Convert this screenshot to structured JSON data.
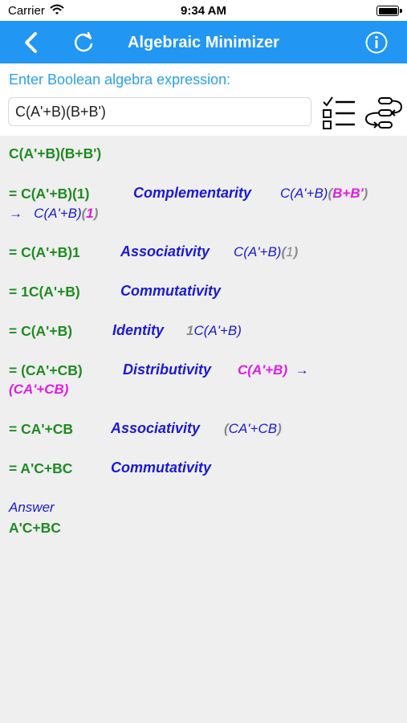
{
  "status_bar": {
    "carrier": "Carrier",
    "time": "9:34 AM",
    "battery_level": 0.9
  },
  "nav": {
    "title": "Algebraic Minimizer",
    "back_icon": "chevron-left-icon",
    "refresh_icon": "refresh-icon",
    "info_icon": "info-icon"
  },
  "input": {
    "prompt": "Enter Boolean algebra expression:",
    "value": "C(A'+B)(B+B')"
  },
  "colors": {
    "nav_blue": "#2196f3",
    "step_green": "#1f8b22",
    "law_blue": "#1a1ad6",
    "highlight_magenta": "#e01ce6",
    "muted_gray": "#8a8a8a"
  },
  "steps": {
    "initial": "C(A'+B)(B+B')",
    "s1": {
      "expr": "= C(A'+B)(1)",
      "law": "Complementarity",
      "n1": "C(A'+B)",
      "n2": "(",
      "n3": "B+B'",
      "n4": ")",
      "arrow": "→",
      "n5": "C(A'+B)",
      "n6": "(",
      "n7": "1",
      "n8": ")"
    },
    "s2": {
      "expr": "= C(A'+B)1",
      "law": "Associativity",
      "n1": "C(A'+B)",
      "n2": "(",
      "n3": "1",
      "n4": ")"
    },
    "s3": {
      "expr": "= 1C(A'+B)",
      "law": "Commutativity"
    },
    "s4": {
      "expr": "= C(A'+B)",
      "law": "Identity",
      "n1": "1",
      "n2": "C(A'+B)"
    },
    "s5": {
      "expr": "= (CA'+CB)",
      "law": "Distributivity",
      "n1": "C(A'+B)",
      "arrow": "→",
      "n2": "(CA'+CB)"
    },
    "s6": {
      "expr": "= CA'+CB",
      "law": "Associativity",
      "n1": "(",
      "n2": "CA'+CB",
      "n3": ")"
    },
    "s7": {
      "expr": "= A'C+BC",
      "law": "Commutativity"
    }
  },
  "answer": {
    "label": "Answer",
    "value": "A'C+BC"
  }
}
